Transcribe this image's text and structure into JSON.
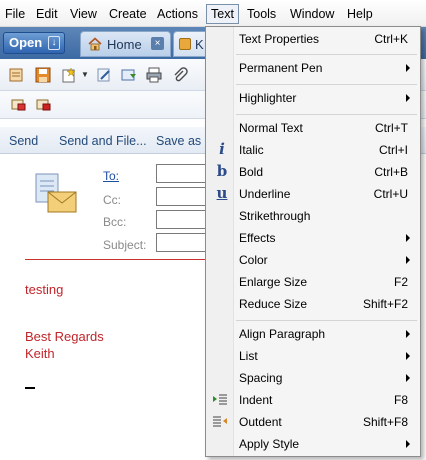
{
  "menubar": {
    "items": [
      {
        "label": "File"
      },
      {
        "label": "Edit"
      },
      {
        "label": "View"
      },
      {
        "label": "Create"
      },
      {
        "label": "Actions"
      },
      {
        "label": "Text"
      },
      {
        "label": "Tools"
      },
      {
        "label": "Window"
      },
      {
        "label": "Help"
      }
    ]
  },
  "tabs": {
    "open_label": "Open",
    "home_label": "Home",
    "mail_label": "K"
  },
  "actionbar": {
    "send": "Send",
    "send_and_file": "Send and File...",
    "save_as": "Save as"
  },
  "compose": {
    "to_label": "To:",
    "cc_label": "Cc:",
    "bcc_label": "Bcc:",
    "subject_label": "Subject:",
    "body_line1": "testing",
    "body_line2": "Best Regards",
    "body_line3": "Keith"
  },
  "text_menu": {
    "text_properties": {
      "label": "Text Properties",
      "shortcut": "Ctrl+K"
    },
    "permanent_pen": {
      "label": "Permanent Pen"
    },
    "highlighter": {
      "label": "Highlighter"
    },
    "normal_text": {
      "label": "Normal Text",
      "shortcut": "Ctrl+T"
    },
    "italic": {
      "label": "Italic",
      "shortcut": "Ctrl+I",
      "icon_glyph": "i"
    },
    "bold": {
      "label": "Bold",
      "shortcut": "Ctrl+B",
      "icon_glyph": "b"
    },
    "underline": {
      "label": "Underline",
      "shortcut": "Ctrl+U",
      "icon_glyph": "u"
    },
    "strikethrough": {
      "label": "Strikethrough"
    },
    "effects": {
      "label": "Effects"
    },
    "color": {
      "label": "Color"
    },
    "enlarge_size": {
      "label": "Enlarge Size",
      "shortcut": "F2"
    },
    "reduce_size": {
      "label": "Reduce Size",
      "shortcut": "Shift+F2"
    },
    "align_paragraph": {
      "label": "Align Paragraph"
    },
    "list": {
      "label": "List"
    },
    "spacing": {
      "label": "Spacing"
    },
    "indent": {
      "label": "Indent",
      "shortcut": "F8"
    },
    "outdent": {
      "label": "Outdent",
      "shortcut": "Shift+F8"
    },
    "apply_style": {
      "label": "Apply Style"
    }
  },
  "colors": {
    "tab_bar": "#3c6aa4",
    "body_text": "#c0252a",
    "link_blue": "#1f4fa0"
  }
}
